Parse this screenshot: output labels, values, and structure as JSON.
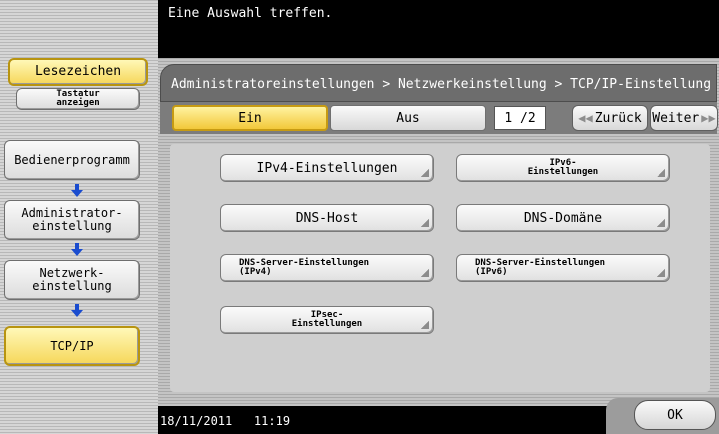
{
  "header": {
    "prompt": "Eine Auswahl treffen."
  },
  "sidebar": {
    "bookmark_label": "Lesezeichen",
    "keyboard_label": "Tastatur anzeigen",
    "path": [
      {
        "label": "Bedienerprogramm"
      },
      {
        "label": "Administrator-\neinstellung"
      },
      {
        "label": "Netzwerk-\neinstellung"
      },
      {
        "label": "TCP/IP"
      }
    ]
  },
  "breadcrumb": "Administratoreinstellungen > Netzwerkeinstellung > TCP/IP-Einstellung",
  "toggle": {
    "on_label": "Ein",
    "off_label": "Aus",
    "selected": "Ein"
  },
  "pagination": {
    "counter": "1 /2",
    "back_label": "Zurück",
    "next_label": "Weiter"
  },
  "settings": [
    {
      "label": "IPv4-Einstellungen"
    },
    {
      "label": "IPv6-\nEinstellungen"
    },
    {
      "label": "DNS-Host"
    },
    {
      "label": "DNS-Domäne"
    },
    {
      "label": "DNS-Server-Einstellungen\n(IPv4)"
    },
    {
      "label": "DNS-Server-Einstellungen\n(IPv6)"
    },
    {
      "label": "IPsec-\nEinstellungen"
    }
  ],
  "footer": {
    "datetime": "18/11/2011   11:19",
    "ok_label": "OK"
  },
  "colors": {
    "selected_yellow": "#f6d75a",
    "header_bg": "#000000",
    "breadcrumb_bg": "#6d6d6d"
  }
}
